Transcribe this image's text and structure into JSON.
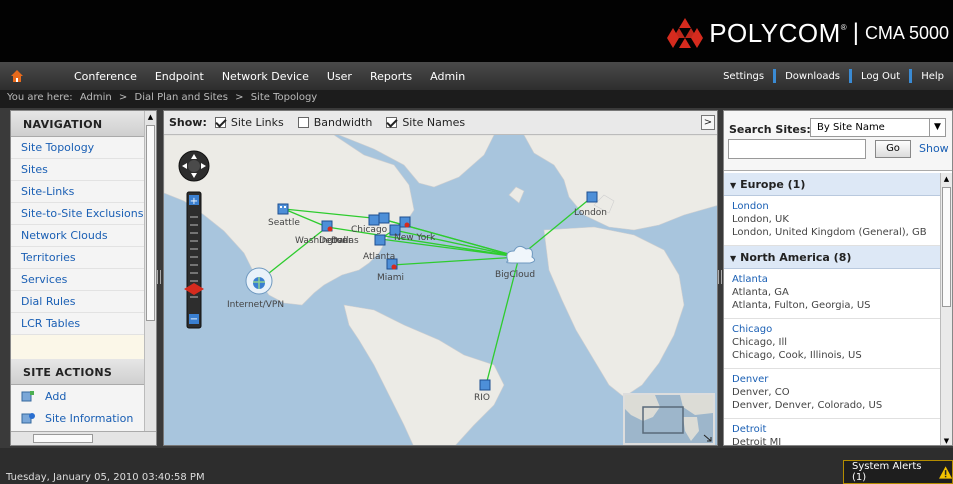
{
  "header": {
    "brand": "POLYCOM",
    "brand_mark": "®",
    "separator": "|",
    "product": "CMA 5000"
  },
  "menu": {
    "items": [
      "Conference",
      "Endpoint",
      "Network Device",
      "User",
      "Reports",
      "Admin"
    ],
    "utility": [
      "Settings",
      "Downloads",
      "Log Out",
      "Help"
    ]
  },
  "breadcrumb": {
    "prefix": "You are here:",
    "path": [
      "Admin",
      ">",
      "Dial Plan and Sites",
      ">",
      "Site Topology"
    ]
  },
  "navigation": {
    "title": "NAVIGATION",
    "items": [
      "Site Topology",
      "Sites",
      "Site-Links",
      "Site-to-Site Exclusions",
      "Network Clouds",
      "Territories",
      "Services",
      "Dial Rules",
      "LCR Tables"
    ]
  },
  "site_actions": {
    "title": "SITE ACTIONS",
    "items": [
      "Add",
      "Site Information"
    ]
  },
  "show_bar": {
    "label": "Show:",
    "options": [
      {
        "label": "Site Links",
        "checked": true
      },
      {
        "label": "Bandwidth",
        "checked": false
      },
      {
        "label": "Site Names",
        "checked": true
      }
    ],
    "collapse": ">"
  },
  "map": {
    "labels": [
      "Seattle",
      "Chicago",
      "New York",
      "Denver",
      "Dallas",
      "Washington",
      "Atlanta",
      "Miami",
      "London",
      "BigCloud",
      "Internet/VPN",
      "RIO"
    ]
  },
  "search": {
    "label": "Search Sites:",
    "mode": "By Site Name",
    "go": "Go",
    "show_all": "Show All"
  },
  "results": {
    "groups": [
      {
        "name": "Europe (1)",
        "sites": [
          {
            "name": "London",
            "line1": "London, UK",
            "line2": "London, United Kingdom (General), GB"
          }
        ]
      },
      {
        "name": "North America (8)",
        "sites": [
          {
            "name": "Atlanta",
            "line1": "Atlanta, GA",
            "line2": "Atlanta, Fulton, Georgia, US"
          },
          {
            "name": "Chicago",
            "line1": "Chicago, Ill",
            "line2": "Chicago, Cook, Illinois, US"
          },
          {
            "name": "Denver",
            "line1": "Denver, CO",
            "line2": "Denver, Denver, Colorado, US"
          },
          {
            "name": "Detroit",
            "line1": "Detroit MI",
            "line2": ""
          }
        ]
      }
    ]
  },
  "status": {
    "datetime": "Tuesday, January 05, 2010 03:40:58 PM",
    "alerts": "System Alerts (1)"
  },
  "colors": {
    "link": "#1a5fb4",
    "site_line": "#2ecc2e",
    "brand_red": "#d52b1e",
    "accent_blue": "#3a8bd4"
  }
}
